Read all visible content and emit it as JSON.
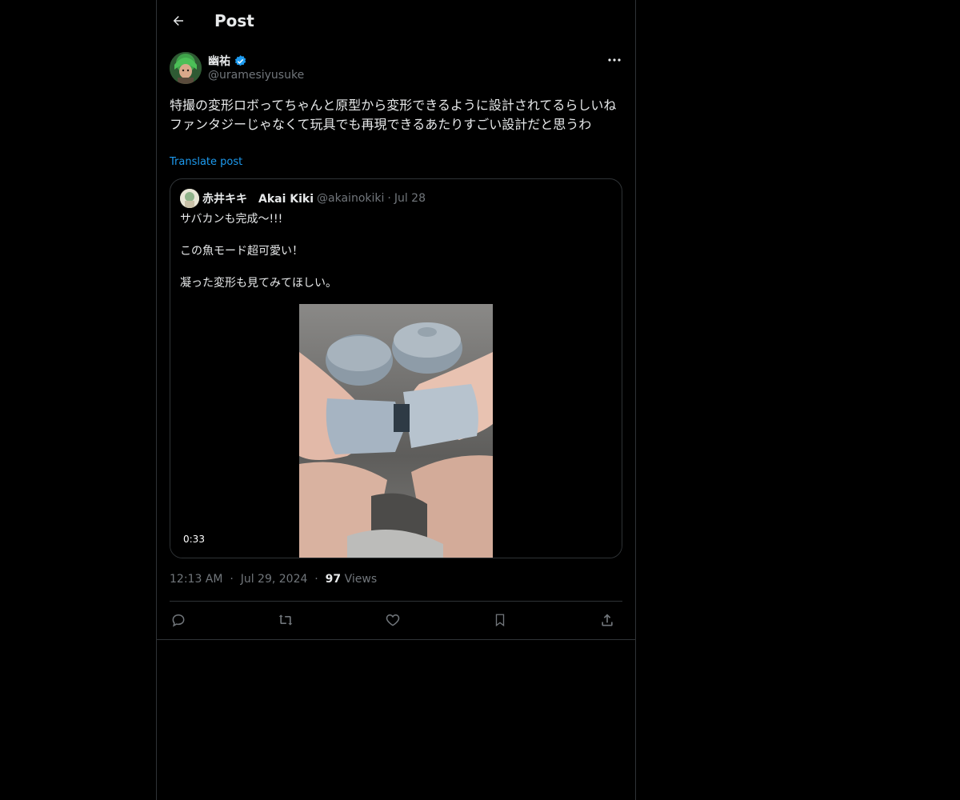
{
  "header": {
    "title": "Post",
    "back_icon": "arrow-left-icon"
  },
  "post": {
    "author_name": "幽祐",
    "author_handle": "@uramesiyusuke",
    "verified": true,
    "text": "特撮の変形ロボってちゃんと原型から変形できるように設計されてるらしいね\nファンタジーじゃなくて玩具でも再現できるあたりすごい設計だと思うわ",
    "translate_label": "Translate post",
    "time": "12:13 AM",
    "date": "Jul 29, 2024",
    "views_count": "97",
    "views_label": "Views"
  },
  "quote": {
    "author_name": "赤井キキ　Akai Kiki",
    "author_handle": "@akainokiki",
    "dot": "·",
    "date": "Jul 28",
    "lines": [
      "サバカンも完成〜!!!",
      "この魚モード超可愛い！",
      "凝った変形も見てみてほしい。"
    ],
    "video_duration": "0:33"
  },
  "actions": [
    {
      "name": "reply-icon"
    },
    {
      "name": "repost-icon"
    },
    {
      "name": "like-icon"
    },
    {
      "name": "bookmark-icon"
    },
    {
      "name": "share-icon"
    }
  ],
  "colors": {
    "background": "#000000",
    "text": "#e7e9ea",
    "secondary": "#71767b",
    "accent": "#1d9bf0",
    "border": "#2f3336"
  }
}
